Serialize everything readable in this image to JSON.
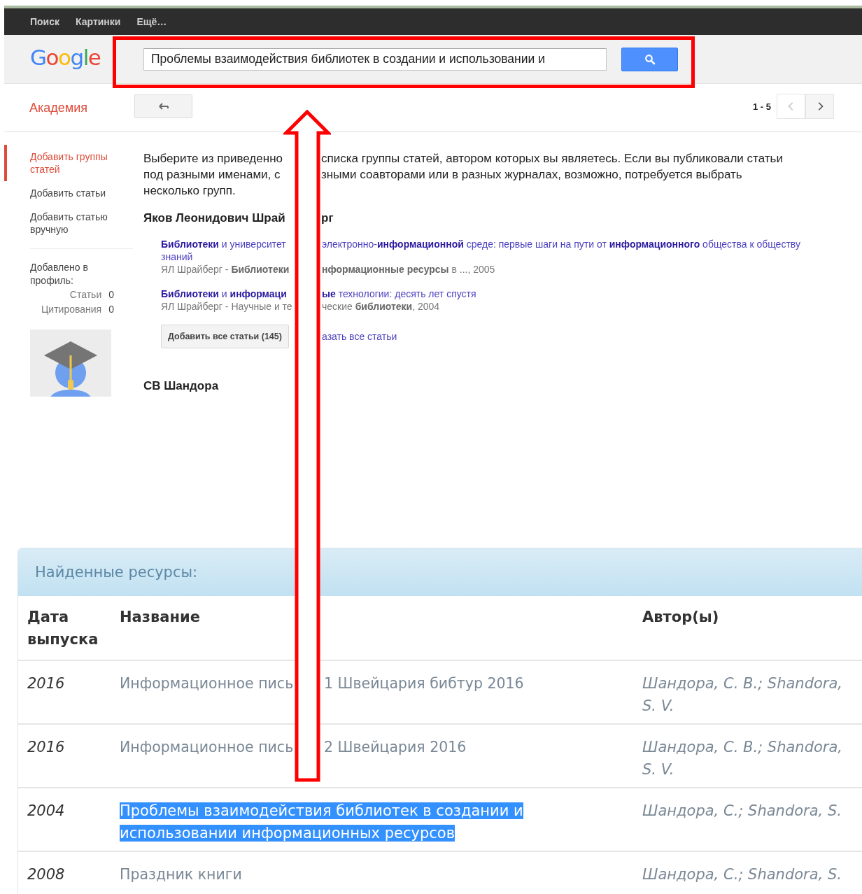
{
  "top_bar": {
    "links": [
      "Поиск",
      "Картинки",
      "Ещё…"
    ]
  },
  "header": {
    "logo": "Google",
    "search": {
      "value": "Проблемы взаимодействия библиотек в создании и использовании и"
    }
  },
  "toolbar": {
    "section": "Академия",
    "range": "1 - 5",
    "prev": {
      "disabled": true
    },
    "next": {
      "disabled": false
    }
  },
  "sidebar": {
    "items": [
      {
        "label": "Добавить группы статей",
        "selected": true
      },
      {
        "label": "Добавить статьи",
        "selected": false
      },
      {
        "label": "Добавить статью вручную",
        "selected": false
      }
    ],
    "added_label": "Добавлено в профиль:",
    "stats": [
      {
        "label": "Статьи",
        "value": "0"
      },
      {
        "label": "Цитирования",
        "value": "0"
      }
    ]
  },
  "main": {
    "intro": [
      {
        "left": "Выберите из приведенно",
        "right": "списка группы статей, автором которых вы являетесь. Если вы публиковали статьи"
      },
      {
        "left": "под разными именами, с",
        "right": "зными соавторами или в разных журналах, возможно, потребуется выбрать"
      },
      {
        "left": "несколько групп."
      }
    ],
    "groups": [
      {
        "author": [
          {
            "left": "Яков Леонидович Шрай",
            "right": "рг"
          }
        ],
        "articles": [
          {
            "title": [
              {
                "left": "**Библиотеки** и университет",
                "right": "электронно-**информационной** среде: первые шаги на пути от **информационного** общества к обществу"
              },
              {
                "left": "знаний"
              }
            ],
            "meta": [
              {
                "left": "ЯЛ Шрайберг - **Библиотеки**",
                "right": "**нформационные ресурсы** в ..., 2005"
              }
            ]
          },
          {
            "title": [
              {
                "left": "**Библиотеки** и **информаци**",
                "right": "**ые** технологии: десять лет спустя"
              }
            ],
            "meta": [
              {
                "left": "ЯЛ Шрайберг - Научные и те",
                "right": "ческие **библиотеки**, 2004"
              }
            ]
          }
        ],
        "add_button": "Добавить все статьи (145)",
        "show_link": "азать все статьи"
      },
      {
        "author": [
          {
            "left": "СВ Шандора"
          }
        ]
      }
    ]
  },
  "resources": {
    "title": "Найденные ресурсы:",
    "columns": [
      "Дата выпуска",
      "Название",
      "Автор(ы)"
    ],
    "rows": [
      {
        "date": "2016",
        "title": [
          {
            "left": "Информационное пись",
            "right": "1 Швейцария бибтур 2016"
          }
        ],
        "authors": "Шандора, С. В.; Shandora, S. V.",
        "selected": false
      },
      {
        "date": "2016",
        "title": [
          {
            "left": "Информационное пись",
            "right": "2 Швейцария 2016"
          }
        ],
        "authors": "Шандора, С. В.; Shandora, S. V.",
        "selected": false
      },
      {
        "date": "2004",
        "title": [
          {
            "left": "Проблемы взаимодействия библиотек в создании и"
          },
          {
            "left": "использовании информационных ресурсов"
          }
        ],
        "authors": "Шандора, С.; Shandora, S.",
        "selected": true
      },
      {
        "date": "2008",
        "title": [
          {
            "left": "Праздник книги"
          }
        ],
        "authors": "Шандора, С.; Shandora, S.",
        "selected": false
      }
    ]
  }
}
